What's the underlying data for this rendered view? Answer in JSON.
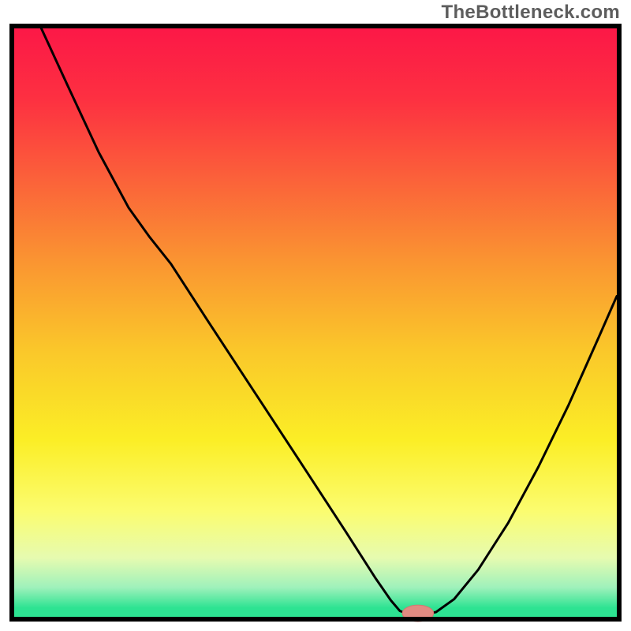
{
  "watermark": "TheBottleneck.com",
  "chart_data": {
    "type": "line",
    "title": "",
    "xlabel": "",
    "ylabel": "",
    "xlim": [
      0,
      100
    ],
    "ylim": [
      0,
      100
    ],
    "axis_visible": false,
    "border": true,
    "background_gradient": {
      "stops": [
        {
          "offset": 0.0,
          "color": "#fc1847"
        },
        {
          "offset": 0.12,
          "color": "#fd3041"
        },
        {
          "offset": 0.25,
          "color": "#fb5f3a"
        },
        {
          "offset": 0.4,
          "color": "#fa9631"
        },
        {
          "offset": 0.55,
          "color": "#fac82a"
        },
        {
          "offset": 0.7,
          "color": "#fbee26"
        },
        {
          "offset": 0.82,
          "color": "#fbfc6f"
        },
        {
          "offset": 0.9,
          "color": "#e6fbb0"
        },
        {
          "offset": 0.95,
          "color": "#9ff1bb"
        },
        {
          "offset": 0.985,
          "color": "#2de392"
        },
        {
          "offset": 1.0,
          "color": "#2de392"
        }
      ]
    },
    "series": [
      {
        "name": "bottleneck-curve",
        "color": "#000000",
        "width": 3,
        "points": [
          {
            "x": 4.5,
            "y": 100.0
          },
          {
            "x": 9.0,
            "y": 90.0
          },
          {
            "x": 14.0,
            "y": 79.0
          },
          {
            "x": 19.0,
            "y": 69.5
          },
          {
            "x": 22.5,
            "y": 64.5
          },
          {
            "x": 26.0,
            "y": 60.0
          },
          {
            "x": 32.0,
            "y": 50.5
          },
          {
            "x": 40.0,
            "y": 38.0
          },
          {
            "x": 48.0,
            "y": 25.5
          },
          {
            "x": 55.0,
            "y": 14.5
          },
          {
            "x": 60.0,
            "y": 6.5
          },
          {
            "x": 62.5,
            "y": 2.8
          },
          {
            "x": 64.0,
            "y": 1.0
          },
          {
            "x": 65.5,
            "y": 0.4
          },
          {
            "x": 68.0,
            "y": 0.4
          },
          {
            "x": 70.0,
            "y": 0.8
          },
          {
            "x": 73.0,
            "y": 3.0
          },
          {
            "x": 77.0,
            "y": 8.0
          },
          {
            "x": 82.0,
            "y": 16.0
          },
          {
            "x": 87.0,
            "y": 25.5
          },
          {
            "x": 92.0,
            "y": 36.0
          },
          {
            "x": 97.0,
            "y": 47.5
          },
          {
            "x": 100.0,
            "y": 54.5
          }
        ]
      }
    ],
    "marker": {
      "name": "optimal-point",
      "x": 67.0,
      "y": 0.6,
      "rx": 2.6,
      "ry": 1.4,
      "fill": "#e18b82",
      "stroke": "#cf7a72"
    }
  }
}
